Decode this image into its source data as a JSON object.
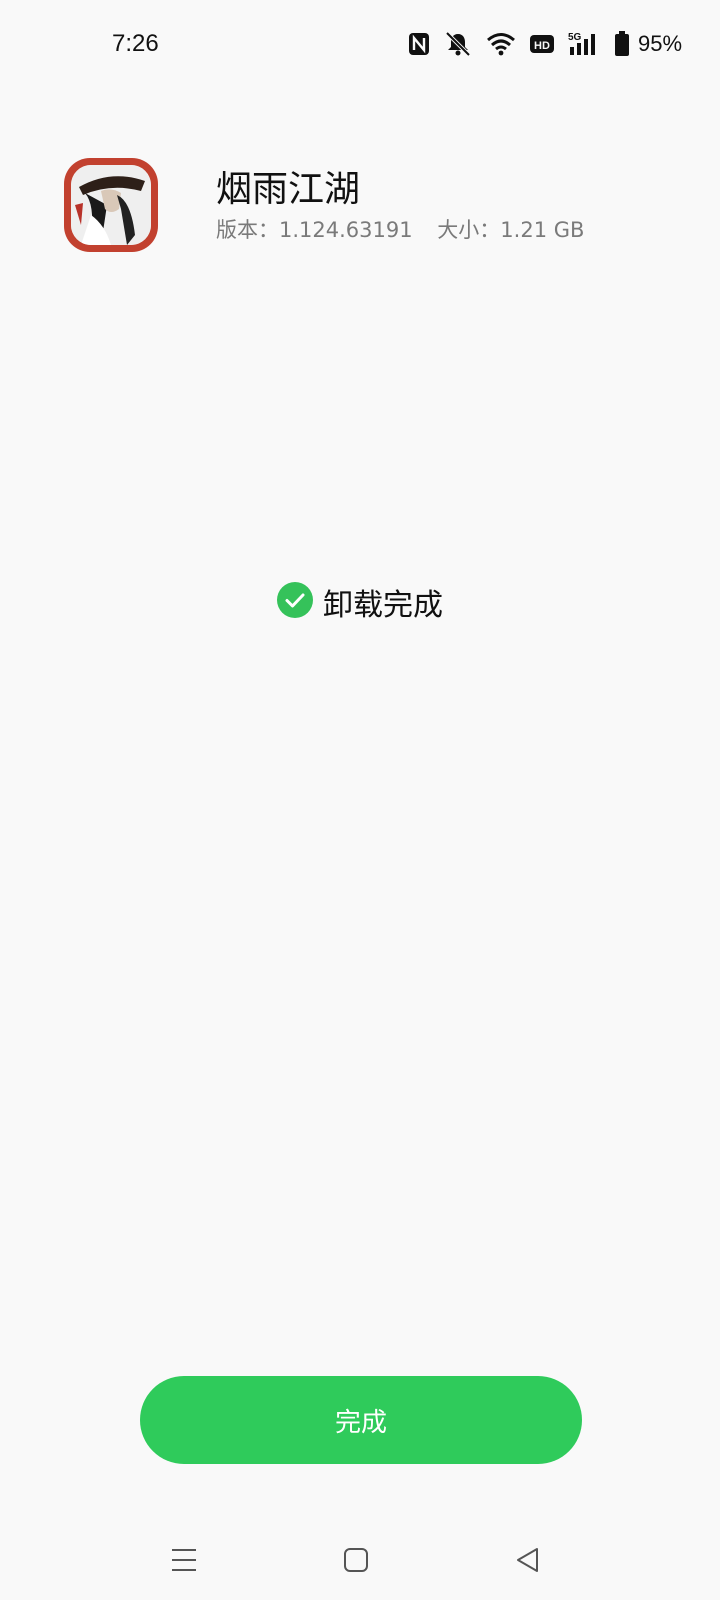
{
  "status_bar": {
    "time": "7:26",
    "battery_percent": "95%",
    "icons": [
      "nfc-icon",
      "bell-muted-icon",
      "wifi-icon",
      "hd-icon",
      "signal-5g-icon",
      "battery-icon"
    ]
  },
  "app": {
    "name": "烟雨江湖",
    "version": "版本：1.124.63191",
    "size": "大小：1.21 GB",
    "icon": "app-game-icon"
  },
  "result": {
    "icon": "check-circle-icon",
    "text": "卸载完成",
    "color": "#35c25a"
  },
  "done_button": {
    "label": "完成",
    "color": "#2fcb5b"
  },
  "nav_bar": {
    "icons": [
      "menu-icon",
      "home-icon",
      "back-icon"
    ]
  }
}
